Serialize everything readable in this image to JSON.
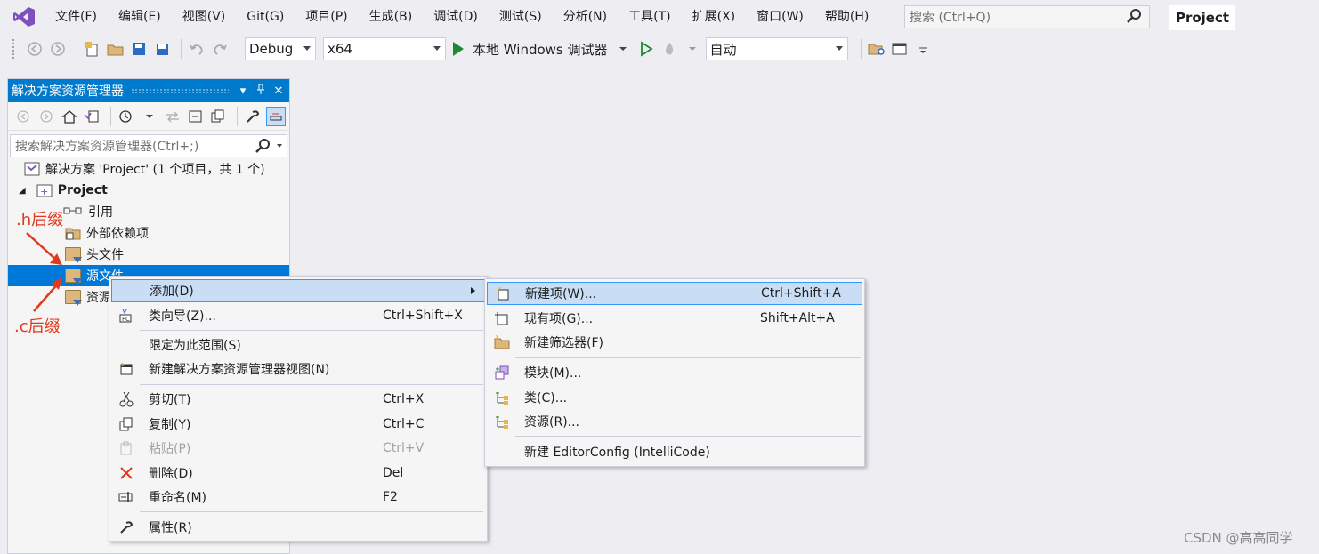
{
  "menubar": {
    "items": [
      "文件(F)",
      "编辑(E)",
      "视图(V)",
      "Git(G)",
      "项目(P)",
      "生成(B)",
      "调试(D)",
      "测试(S)",
      "分析(N)",
      "工具(T)",
      "扩展(X)",
      "窗口(W)",
      "帮助(H)"
    ],
    "search_placeholder": "搜索 (Ctrl+Q)",
    "project_name": "Project"
  },
  "toolbar": {
    "config": "Debug",
    "platform": "x64",
    "debugger_label": "本地 Windows 调试器",
    "auto_label": "自动"
  },
  "solution_explorer": {
    "title": "解决方案资源管理器",
    "search_placeholder": "搜索解决方案资源管理器(Ctrl+;)",
    "tree": [
      {
        "label": "解决方案 'Project' (1 个项目，共 1 个)"
      },
      {
        "label": "Project"
      },
      {
        "label": "引用"
      },
      {
        "label": "外部依赖项"
      },
      {
        "label": "头文件"
      },
      {
        "label": "源文件"
      },
      {
        "label": "资源"
      }
    ]
  },
  "annotations": {
    "h_suffix": ".h后缀",
    "c_suffix": ".c后缀"
  },
  "context_menu": {
    "items": [
      {
        "label": "添加(D)",
        "shortcut": ""
      },
      {
        "label": "类向导(Z)...",
        "shortcut": "Ctrl+Shift+X"
      },
      {
        "label": "限定为此范围(S)",
        "shortcut": ""
      },
      {
        "label": "新建解决方案资源管理器视图(N)",
        "shortcut": ""
      },
      {
        "label": "剪切(T)",
        "shortcut": "Ctrl+X"
      },
      {
        "label": "复制(Y)",
        "shortcut": "Ctrl+C"
      },
      {
        "label": "粘贴(P)",
        "shortcut": "Ctrl+V"
      },
      {
        "label": "删除(D)",
        "shortcut": "Del"
      },
      {
        "label": "重命名(M)",
        "shortcut": "F2"
      },
      {
        "label": "属性(R)",
        "shortcut": ""
      }
    ]
  },
  "submenu": {
    "items": [
      {
        "label": "新建项(W)...",
        "shortcut": "Ctrl+Shift+A"
      },
      {
        "label": "现有项(G)...",
        "shortcut": "Shift+Alt+A"
      },
      {
        "label": "新建筛选器(F)",
        "shortcut": ""
      },
      {
        "label": "模块(M)...",
        "shortcut": ""
      },
      {
        "label": "类(C)...",
        "shortcut": ""
      },
      {
        "label": "资源(R)...",
        "shortcut": ""
      },
      {
        "label": "新建 EditorConfig (IntelliCode)",
        "shortcut": ""
      }
    ]
  },
  "watermark": "CSDN @高高同学",
  "colors": {
    "accent": "#007acc",
    "selection": "#0078d7",
    "menu_highlight": "#c9def5",
    "annotation": "#e03a1e"
  }
}
